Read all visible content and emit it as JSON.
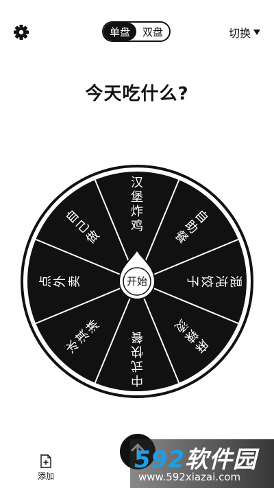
{
  "topbar": {
    "mode_tabs": [
      {
        "label": "单盘",
        "active": true
      },
      {
        "label": "双盘",
        "active": false
      }
    ],
    "switch_label": "切换",
    "icons": {
      "settings": "gear-icon",
      "switch": "caret-down-icon"
    }
  },
  "title": "今天吃什么?",
  "wheel": {
    "slices": [
      "汉堡炸鸡",
      "自助餐",
      "混沌饺子",
      "麻辣烫",
      "中式快餐",
      "冰淇淋",
      "点外卖",
      "自己做"
    ],
    "center_label": "开始",
    "colors": {
      "slice": "#111111",
      "divider": "#ffffff",
      "rim": "#111111"
    }
  },
  "bottombar": {
    "add_label": "添加",
    "icons": {
      "add": "add-file-icon",
      "primary": "arrow-up-icon"
    }
  },
  "watermark": {
    "brand_number": "592",
    "brand_text": "软件园",
    "url": "www.592xiazai.com"
  }
}
